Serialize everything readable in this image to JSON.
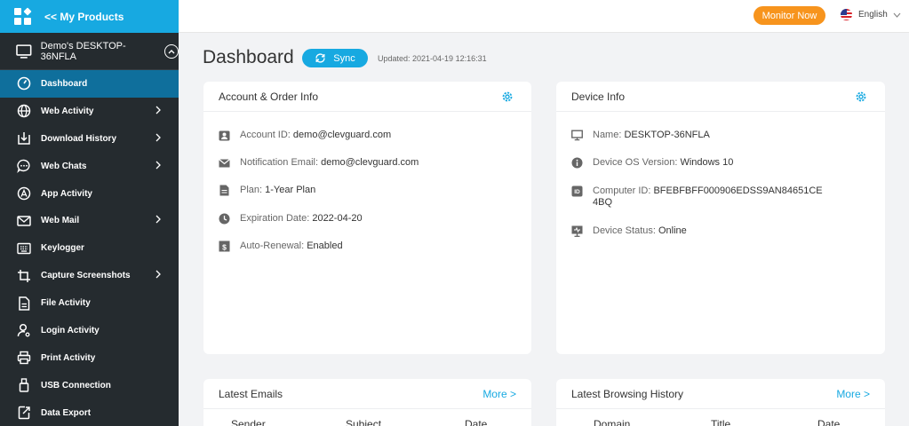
{
  "sidebar": {
    "brand_label": "<< My Products",
    "device_name": "Demo's DESKTOP-36NFLA",
    "items": [
      {
        "label": "Dashboard",
        "icon": "gauge-icon",
        "active": true,
        "has_chevron": false
      },
      {
        "label": "Web Activity",
        "icon": "globe-icon",
        "active": false,
        "has_chevron": true
      },
      {
        "label": "Download History",
        "icon": "download-icon",
        "active": false,
        "has_chevron": true
      },
      {
        "label": "Web Chats",
        "icon": "chat-icon",
        "active": false,
        "has_chevron": true
      },
      {
        "label": "App Activity",
        "icon": "app-store-icon",
        "active": false,
        "has_chevron": false
      },
      {
        "label": "Web Mail",
        "icon": "mail-icon",
        "active": false,
        "has_chevron": true
      },
      {
        "label": "Keylogger",
        "icon": "keyboard-icon",
        "active": false,
        "has_chevron": false
      },
      {
        "label": "Capture Screenshots",
        "icon": "crop-icon",
        "active": false,
        "has_chevron": true
      },
      {
        "label": "File Activity",
        "icon": "file-icon",
        "active": false,
        "has_chevron": false
      },
      {
        "label": "Login Activity",
        "icon": "user-key-icon",
        "active": false,
        "has_chevron": false
      },
      {
        "label": "Print Activity",
        "icon": "printer-icon",
        "active": false,
        "has_chevron": false
      },
      {
        "label": "USB Connection",
        "icon": "usb-icon",
        "active": false,
        "has_chevron": false
      },
      {
        "label": "Data Export",
        "icon": "export-icon",
        "active": false,
        "has_chevron": false
      }
    ]
  },
  "topbar": {
    "monitor_label": "Monitor Now",
    "language": "English"
  },
  "main": {
    "title": "Dashboard",
    "sync_label": "Sync",
    "updated": "Updated: 2021-04-19 12:16:31"
  },
  "account_card": {
    "title": "Account & Order Info",
    "rows": [
      {
        "icon": "id-card-icon",
        "key": "Account ID: ",
        "value": "demo@clevguard.com"
      },
      {
        "icon": "envelope-icon",
        "key": "Notification Email: ",
        "value": "demo@clevguard.com"
      },
      {
        "icon": "document-icon",
        "key": "Plan: ",
        "value": "1-Year Plan"
      },
      {
        "icon": "clock-icon",
        "key": "Expiration Date: ",
        "value": "2022-04-20"
      },
      {
        "icon": "dollar-icon",
        "key": "Auto-Renewal: ",
        "value": "Enabled"
      }
    ]
  },
  "device_card": {
    "title": "Device Info",
    "rows": [
      {
        "icon": "monitor-icon",
        "key": "Name: ",
        "value": "DESKTOP-36NFLA"
      },
      {
        "icon": "info-icon",
        "key": "Device OS Version: ",
        "value": "Windows 10"
      },
      {
        "icon": "id-badge-icon",
        "key": "Computer ID: ",
        "value": "BFEBFBFF000906EDSS9AN84651CE",
        "value2": "4BQ"
      },
      {
        "icon": "status-monitor-icon",
        "key": "Device Status: ",
        "value": "Online"
      }
    ]
  },
  "emails_card": {
    "title": "Latest Emails",
    "more": "More >",
    "columns": [
      "Sender",
      "Subject",
      "Date"
    ]
  },
  "browsing_card": {
    "title": "Latest Browsing History",
    "more": "More >",
    "columns": [
      "Domain",
      "Title",
      "Date"
    ]
  },
  "colors": {
    "accent": "#17a9e1",
    "sidebar_bg": "#252b2f",
    "active_item": "#0f6f9c",
    "monitor_button": "#f7941d"
  }
}
